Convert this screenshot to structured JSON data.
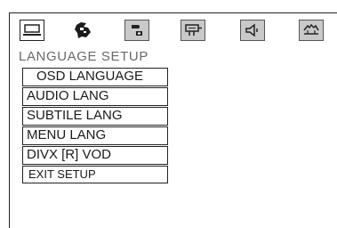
{
  "icon_bar": [
    {
      "name": "monitor-icon"
    },
    {
      "name": "language-icon"
    },
    {
      "name": "speaker-settings-icon"
    },
    {
      "name": "video-plug-icon"
    },
    {
      "name": "audio-speaker-icon"
    },
    {
      "name": "preference-icon"
    }
  ],
  "section_title": "LANGUAGE  SETUP",
  "menu": {
    "items": [
      {
        "label": "OSD LANGUAGE"
      },
      {
        "label": "AUDIO LANG"
      },
      {
        "label": "SUBTILE LANG"
      },
      {
        "label": "MENU  LANG"
      },
      {
        "label": "DIVX [R]  VOD"
      },
      {
        "label": "EXIT SETUP"
      }
    ]
  }
}
